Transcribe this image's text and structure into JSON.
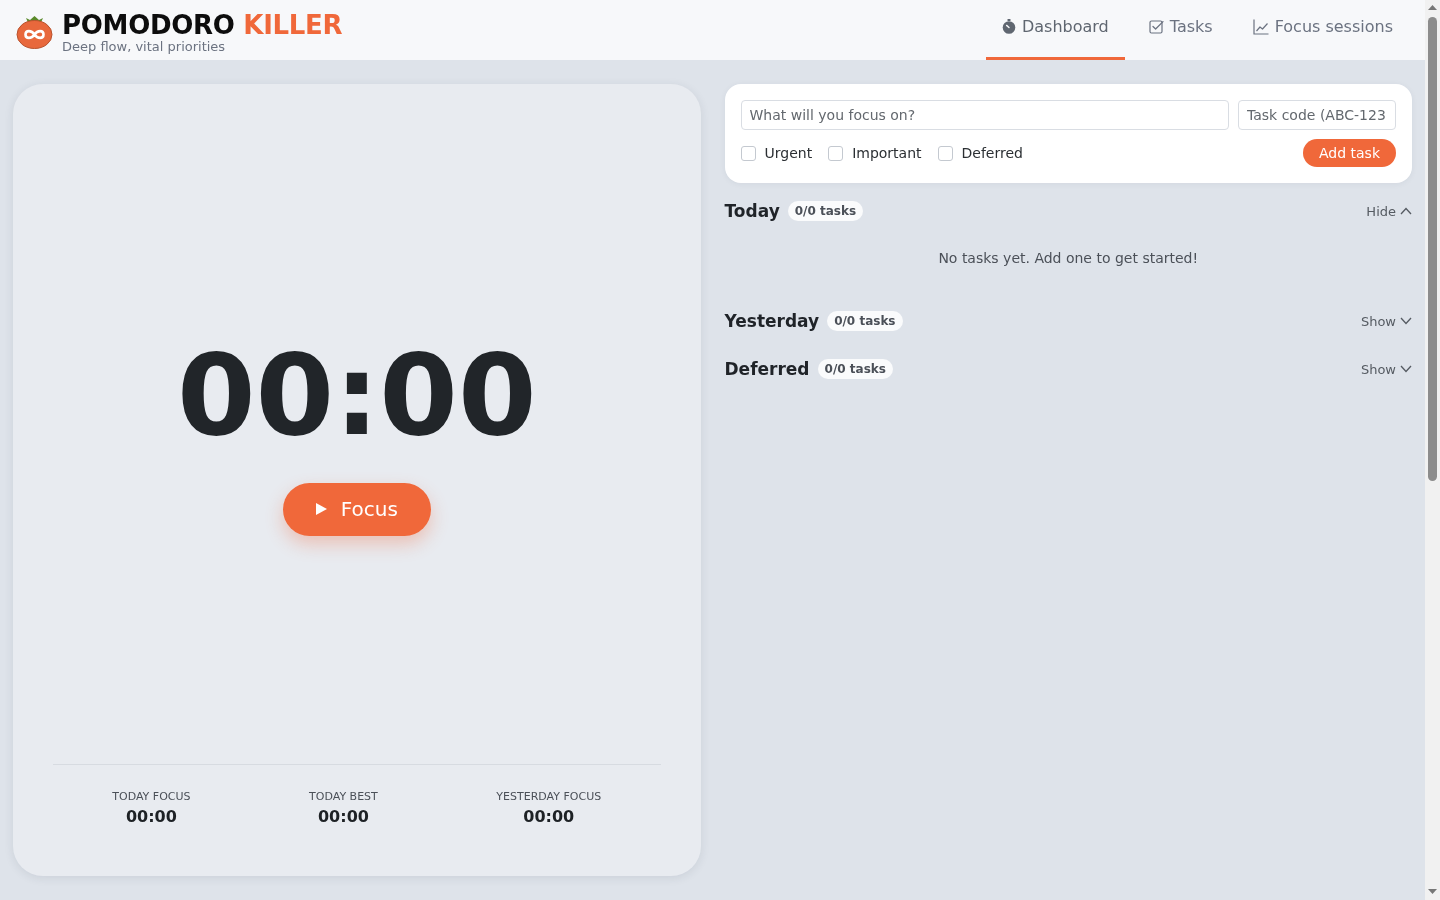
{
  "header": {
    "title": {
      "main": "POMODORO",
      "accent": "KILLER"
    },
    "tagline": "Deep flow, vital priorities"
  },
  "nav": [
    {
      "label": "Dashboard",
      "selected": true
    },
    {
      "label": "Tasks",
      "selected": false
    },
    {
      "label": "Focus sessions",
      "selected": false
    }
  ],
  "timer": {
    "display": "00:00",
    "button": "Focus"
  },
  "stats": [
    {
      "label": "TODAY FOCUS",
      "value": "00:00"
    },
    {
      "label": "TODAY BEST",
      "value": "00:00"
    },
    {
      "label": "YESTERDAY FOCUS",
      "value": "00:00"
    }
  ],
  "task_form": {
    "title_placeholder": "What will you focus on?",
    "code_placeholder": "Task code (ABC-123",
    "options": [
      {
        "label": "Urgent",
        "checked": false
      },
      {
        "label": "Important",
        "checked": false
      },
      {
        "label": "Deferred",
        "checked": false
      }
    ],
    "button": "Add task"
  },
  "sections": [
    {
      "title": "Today",
      "count": "0/0 tasks",
      "toggle": "Hide",
      "expanded": true,
      "empty_message": "No tasks yet. Add one to get started!"
    },
    {
      "title": "Yesterday",
      "count": "0/0 tasks",
      "toggle": "Show",
      "expanded": false
    },
    {
      "title": "Deferred",
      "count": "0/0 tasks",
      "toggle": "Show",
      "expanded": false
    }
  ]
}
